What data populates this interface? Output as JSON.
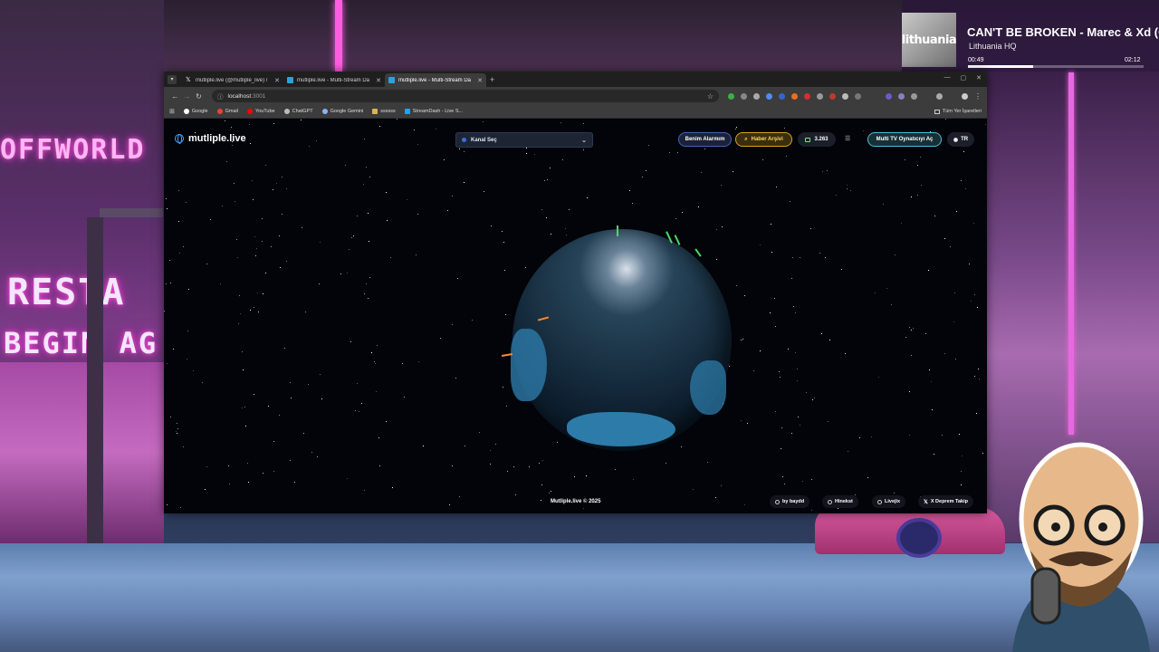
{
  "music": {
    "art_text": "lithuania",
    "title": "CAN'T BE BROKEN - Marec & Xd (O",
    "artist": "Lithuania HQ",
    "elapsed": "00:49",
    "duration": "02:12",
    "progress": 0.37
  },
  "background": {
    "sign_offworld": "OFFWORLD",
    "sign_restart": "RESTA",
    "sign_begin": "BEGIN AG"
  },
  "browser": {
    "tabs": [
      {
        "label": "mutliple.live (@mutliple_live) /",
        "icon": "x-logo-icon",
        "active": false
      },
      {
        "label": "mutliple.live - Multi-Stream Da",
        "icon": "app-favicon",
        "active": false
      },
      {
        "label": "mutliple.live - Multi-Stream Da",
        "icon": "app-favicon",
        "active": true
      }
    ],
    "url_host": "localhost",
    "url_port": ":3001",
    "bookmarks": [
      {
        "label": "Google",
        "color": "#ffffff"
      },
      {
        "label": "Gmail",
        "color": "#ea4335"
      },
      {
        "label": "YouTube",
        "color": "#ff0000"
      },
      {
        "label": "ChatGPT",
        "color": "#bbbbbb"
      },
      {
        "label": "Google Gemini",
        "color": "#8ab4f8"
      },
      {
        "label": "ssssss",
        "color": "#d8b35a"
      },
      {
        "label": "StreamDash - Live S...",
        "color": "#2aa1e0"
      }
    ],
    "all_bookmarks": "Tüm Yer İşaretleri"
  },
  "page": {
    "logo": "mutliple.live",
    "channel_select": "Kanal Seç",
    "alarm_button": "Benim Alarmım",
    "news_button": "Haber Arşivi",
    "viewer_count": "3.263",
    "multi_tv_button": "Multi TV Oynatıcıyı Aç",
    "lang_button": "TR",
    "copyright": "Mutliple.live © 2025",
    "footer_links": [
      "by baydd",
      "Hinekst",
      "Livejix",
      "X Deprem Takip"
    ]
  },
  "colors": {
    "accent_blue": "#4462b8",
    "news_gold": "#d4a61a",
    "multi_cyan": "#4bbfd2",
    "marker_green": "#4cd964",
    "marker_orange": "#ff8a2a"
  }
}
